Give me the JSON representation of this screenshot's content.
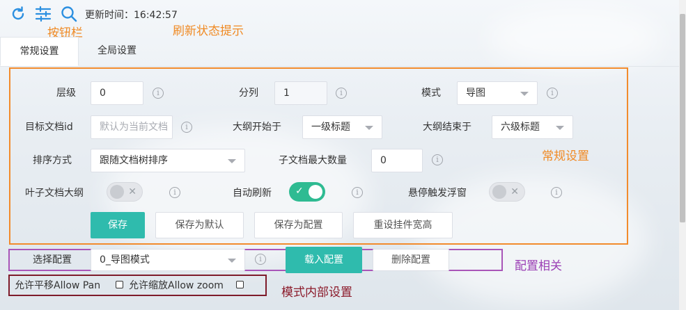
{
  "toolbar": {
    "refresh_label": "更新时间：16:42:57",
    "buttons": [
      "refresh-icon",
      "sliders-icon",
      "search-icon"
    ],
    "accent_color": "#2b8fe0"
  },
  "annotations": {
    "toolbar_area": "按钮栏",
    "refresh_status": "刷新状态提示",
    "general_settings": "常规设置",
    "config_related": "配置相关",
    "mode_internal": "模式内部设置"
  },
  "tabs": [
    {
      "label": "常规设置",
      "active": true
    },
    {
      "label": "全局设置",
      "active": false
    }
  ],
  "form": {
    "level": {
      "label": "层级",
      "value": "0"
    },
    "columns": {
      "label": "分列",
      "value": "1"
    },
    "mode": {
      "label": "模式",
      "value": "导图"
    },
    "target_doc": {
      "label": "目标文档id",
      "placeholder": "默认为当前文档"
    },
    "outline_start": {
      "label": "大纲开始于",
      "value": "一级标题"
    },
    "outline_end": {
      "label": "大纲结束于",
      "value": "六级标题"
    },
    "sort": {
      "label": "排序方式",
      "value": "跟随文档树排序"
    },
    "max_children": {
      "label": "子文档最大数量",
      "value": "0"
    },
    "leaf_outline": {
      "label": "叶子文档大纲",
      "on": false
    },
    "auto_refresh": {
      "label": "自动刷新",
      "on": true
    },
    "hover_popup": {
      "label": "悬停触发浮窗",
      "on": false
    },
    "info_glyph": "i"
  },
  "buttons": {
    "save": "保存",
    "save_default": "保存为默认",
    "save_config": "保存为配置",
    "reset_size": "重设挂件宽高"
  },
  "config": {
    "label": "选择配置",
    "value": "0_导图模式",
    "load": "载入配置",
    "delete": "删除配置"
  },
  "mode_settings": {
    "allow_pan": "允许平移Allow Pan",
    "allow_zoom": "允许缩放Allow zoom"
  },
  "colors": {
    "primary": "#2fbbad",
    "switch_on": "#2fbb92",
    "orange_box": "#f28b2c",
    "purple_box": "#a955b8",
    "maroon_box": "#7e1b2a"
  }
}
